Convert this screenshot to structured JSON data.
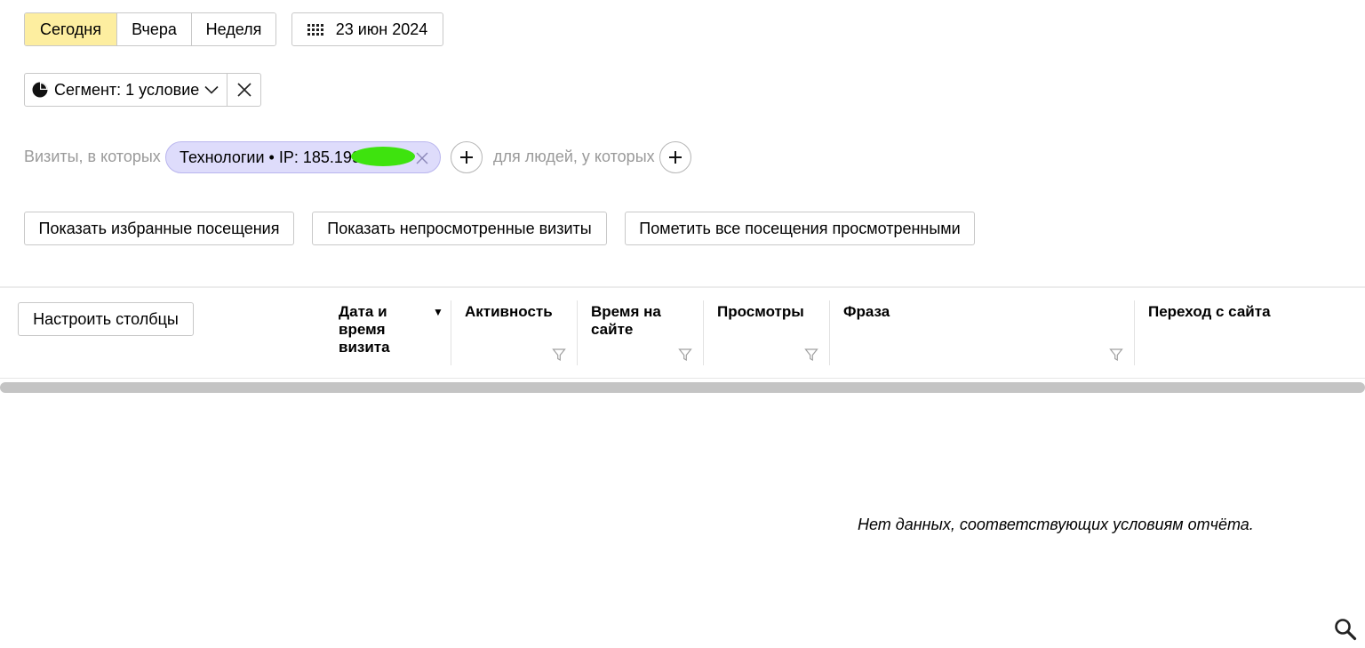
{
  "period": {
    "today": "Сегодня",
    "yesterday": "Вчера",
    "week": "Неделя"
  },
  "date_picker": {
    "label": "23 июн 2024"
  },
  "segment": {
    "label": "Сегмент: 1 условие"
  },
  "conditions": {
    "visits_label": "Визиты, в которых",
    "chip_label": "Технологии • IP: 185.199.",
    "people_label": "для людей, у которых"
  },
  "actions": {
    "show_favorites": "Показать избранные посещения",
    "show_unviewed": "Показать непросмотренные визиты",
    "mark_all_viewed": "Пометить все посещения просмотренными"
  },
  "table": {
    "configure_columns": "Настроить столбцы",
    "columns": [
      {
        "label": "Дата и время визита"
      },
      {
        "label": "Активность"
      },
      {
        "label": "Время на сайте"
      },
      {
        "label": "Просмотры"
      },
      {
        "label": "Фраза"
      },
      {
        "label": "Переход с сайта"
      }
    ],
    "sort_indicator": "▼",
    "empty_message": "Нет данных, соответствующих условиям отчёта."
  },
  "colors": {
    "active_period": "#fdeea0",
    "chip_bg": "#dedcfb",
    "redaction": "#3ee30e"
  }
}
